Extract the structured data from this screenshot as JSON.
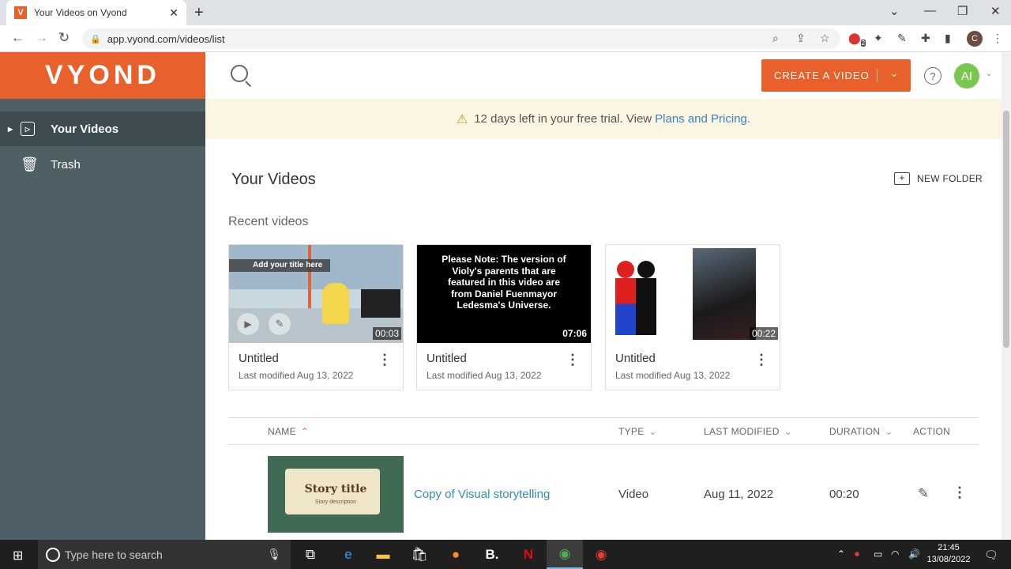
{
  "browser": {
    "tab_title": "Your Videos on Vyond",
    "favicon_letter": "V",
    "url": "app.vyond.com/videos/list",
    "profile_initial": "C",
    "ext_badge": "2"
  },
  "app": {
    "logo": "VYOND",
    "sidebar": {
      "items": [
        {
          "label": "Your Videos"
        },
        {
          "label": "Trash"
        }
      ]
    },
    "topbar": {
      "create_label": "CREATE A VIDEO",
      "avatar_initials": "AI"
    },
    "banner": {
      "text": "12 days left in your free trial. View",
      "link": "Plans and Pricing."
    },
    "page_title": "Your Videos",
    "new_folder_label": "NEW FOLDER",
    "recent_label": "Recent videos",
    "recent_videos": [
      {
        "title": "Untitled",
        "meta": "Last modified Aug 13, 2022",
        "duration": "00:03",
        "overlay_text": "Add your title here"
      },
      {
        "title": "Untitled",
        "meta": "Last modified Aug 13, 2022",
        "duration": "07:06",
        "note": "Please Note: The version of Violy's parents that are featured in this video are from Daniel Fuenmayor Ledesma's Universe."
      },
      {
        "title": "Untitled",
        "meta": "Last modified Aug 13, 2022",
        "duration": "00:22"
      }
    ],
    "table": {
      "headers": {
        "name": "NAME",
        "type": "TYPE",
        "modified": "LAST MODIFIED",
        "duration": "DURATION",
        "action": "ACTION"
      },
      "rows": [
        {
          "name": "Copy of Visual storytelling",
          "type": "Video",
          "modified": "Aug 11, 2022",
          "duration": "00:20",
          "thumb_title": "Story title",
          "thumb_desc": "Story description"
        }
      ]
    }
  },
  "taskbar": {
    "search_placeholder": "Type here to search",
    "time": "21:45",
    "date": "13/08/2022"
  },
  "colors": {
    "brand": "#e8612c",
    "sidebar": "#4f5f66",
    "link": "#3b82c4",
    "avatar": "#7ac74f"
  }
}
